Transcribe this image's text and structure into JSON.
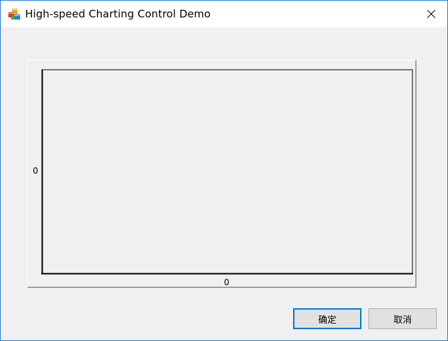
{
  "window": {
    "title": "High-speed Charting Control Demo",
    "app_icon": "app-cubes-icon",
    "close_icon": "close-icon"
  },
  "chart": {
    "y_tick_label": "0",
    "x_tick_label": "0"
  },
  "buttons": {
    "ok_label": "确定",
    "cancel_label": "取消"
  },
  "colors": {
    "title_border": "#2b79d0",
    "dialog_bg": "#f0f0f0",
    "primary_button_border": "#0078d7"
  }
}
